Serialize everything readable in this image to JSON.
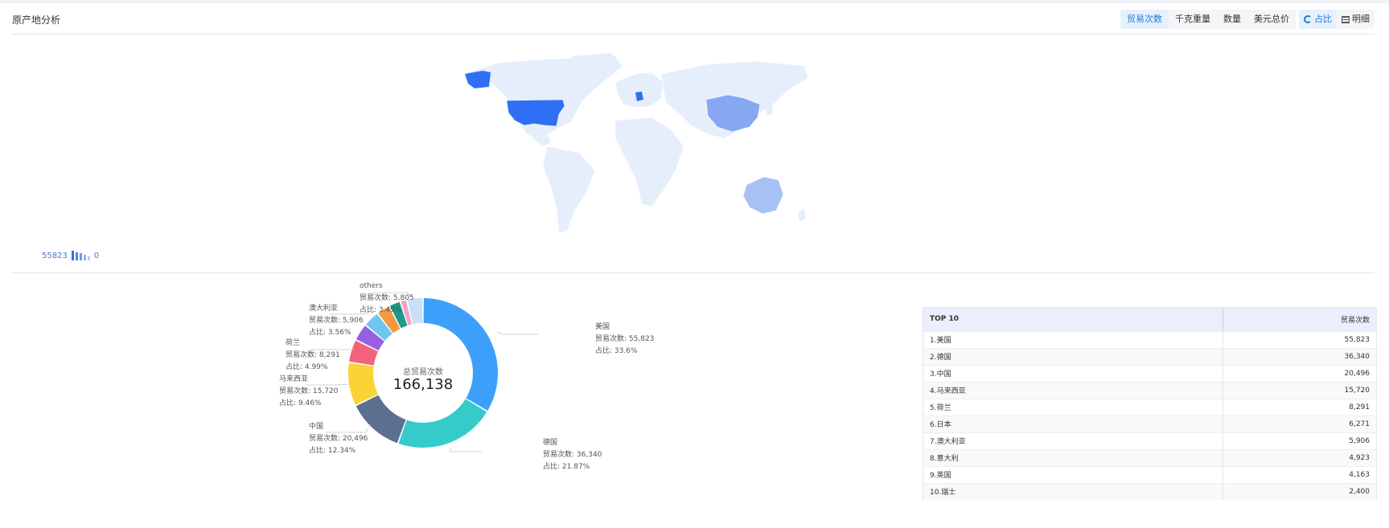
{
  "panel": {
    "title": "原产地分析",
    "metric_tabs": [
      "贸易次数",
      "千克重量",
      "数量",
      "美元总价"
    ],
    "active_metric": "贸易次数",
    "view_tabs": [
      {
        "icon": "pie-icon",
        "label": "占比",
        "active": true
      },
      {
        "icon": "grid-icon",
        "label": "明细",
        "active": false
      }
    ]
  },
  "map": {
    "legend_max": "55823",
    "legend_min": "0",
    "colors": {
      "base": "#e6eefb",
      "usa": "#2f6ff5",
      "china": "#86a8f2",
      "australia": "#a7c1f6",
      "germany": "#2f6ff5"
    }
  },
  "donut": {
    "center_label": "总贸易次数",
    "center_value": "166,138",
    "slices": [
      {
        "name": "美国",
        "count": "55,823",
        "pct": "33.6%",
        "value": 55823,
        "color": "#3ca0fb"
      },
      {
        "name": "德国",
        "count": "36,340",
        "pct": "21.87%",
        "value": 36340,
        "color": "#36cbcb"
      },
      {
        "name": "中国",
        "count": "20,496",
        "pct": "12.34%",
        "value": 20496,
        "color": "#5b6f8f"
      },
      {
        "name": "马来西亚",
        "count": "15,720",
        "pct": "9.46%",
        "value": 15720,
        "color": "#fad337"
      },
      {
        "name": "荷兰",
        "count": "8,291",
        "pct": "4.99%",
        "value": 8291,
        "color": "#f2637b"
      },
      {
        "name": "日本",
        "count": "",
        "pct": "",
        "value": 6271,
        "color": "#975fe4"
      },
      {
        "name": "澳大利亚",
        "count": "5,906",
        "pct": "3.56%",
        "value": 5906,
        "color": "#71c6f0"
      },
      {
        "name": "意大利",
        "count": "",
        "pct": "",
        "value": 4923,
        "color": "#f6983e"
      },
      {
        "name": "英国",
        "count": "",
        "pct": "",
        "value": 4163,
        "color": "#1e9a8a"
      },
      {
        "name": "瑞士",
        "count": "",
        "pct": "",
        "value": 2400,
        "color": "#f6a2c6"
      },
      {
        "name": "others",
        "count": "5,805",
        "pct": "3.49%",
        "value": 5805,
        "color": "#c9e0f7"
      }
    ],
    "count_prefix": "贸易次数: ",
    "pct_prefix": "占比: "
  },
  "table": {
    "headers": [
      "TOP 10",
      "贸易次数"
    ],
    "rows": [
      {
        "name": "1.美国",
        "value": "55,823"
      },
      {
        "name": "2.德国",
        "value": "36,340"
      },
      {
        "name": "3.中国",
        "value": "20,496"
      },
      {
        "name": "4.马来西亚",
        "value": "15,720"
      },
      {
        "name": "5.荷兰",
        "value": "8,291"
      },
      {
        "name": "6.日本",
        "value": "6,271"
      },
      {
        "name": "7.澳大利亚",
        "value": "5,906"
      },
      {
        "name": "8.意大利",
        "value": "4,923"
      },
      {
        "name": "9.英国",
        "value": "4,163"
      },
      {
        "name": "10.瑞士",
        "value": "2,400"
      }
    ]
  }
}
